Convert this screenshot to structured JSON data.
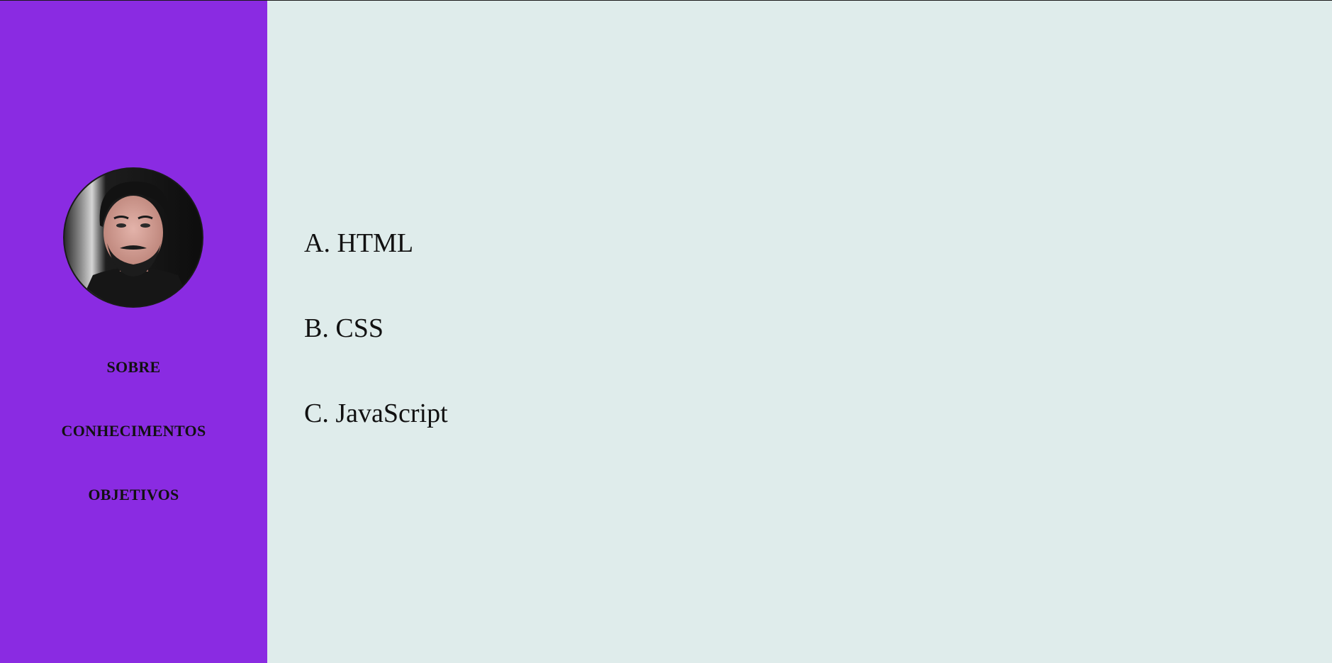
{
  "sidebar": {
    "background": "#8a2be2",
    "avatar_icon": "profile-photo",
    "nav": [
      {
        "label": "SOBRE"
      },
      {
        "label": "CONHECIMENTOS"
      },
      {
        "label": "OBJETIVOS"
      }
    ]
  },
  "main": {
    "background": "#dfeceb",
    "skills": [
      {
        "label": "A. HTML"
      },
      {
        "label": "B. CSS"
      },
      {
        "label": "C. JavaScript"
      }
    ]
  }
}
